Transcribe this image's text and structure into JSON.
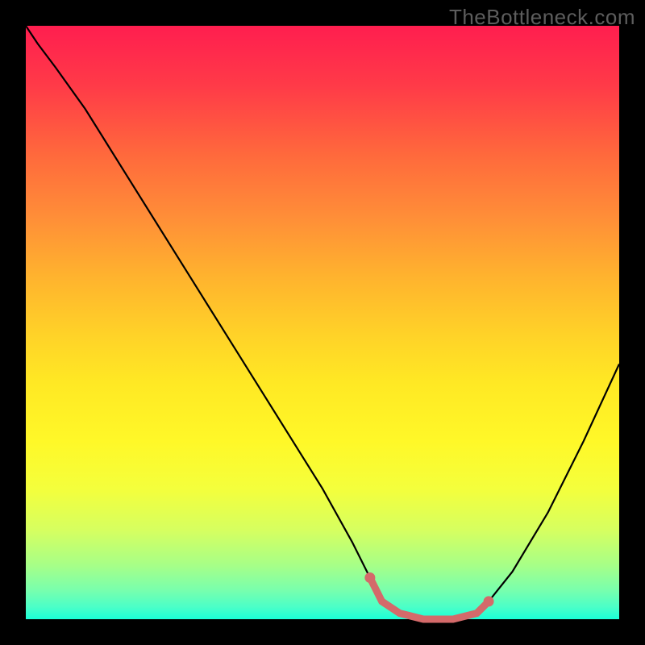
{
  "watermark": "TheBottleneck.com",
  "chart_data": {
    "type": "line",
    "title": "",
    "xlabel": "",
    "ylabel": "",
    "xlim": [
      0,
      1
    ],
    "ylim": [
      0,
      1
    ],
    "series": [
      {
        "name": "bottleneck-curve",
        "color": "#000000",
        "x": [
          0.0,
          0.02,
          0.05,
          0.1,
          0.15,
          0.2,
          0.25,
          0.3,
          0.35,
          0.4,
          0.45,
          0.5,
          0.55,
          0.58,
          0.6,
          0.63,
          0.67,
          0.72,
          0.76,
          0.78,
          0.82,
          0.88,
          0.94,
          1.0
        ],
        "y": [
          1.0,
          0.97,
          0.93,
          0.86,
          0.78,
          0.7,
          0.62,
          0.54,
          0.46,
          0.38,
          0.3,
          0.22,
          0.13,
          0.07,
          0.03,
          0.01,
          0.0,
          0.0,
          0.01,
          0.03,
          0.08,
          0.18,
          0.3,
          0.43
        ]
      },
      {
        "name": "highlight-band",
        "color": "#d46a6a",
        "x": [
          0.58,
          0.6,
          0.63,
          0.67,
          0.72,
          0.76,
          0.78
        ],
        "y": [
          0.07,
          0.03,
          0.01,
          0.0,
          0.0,
          0.01,
          0.03
        ]
      }
    ],
    "highlight_points": [
      {
        "x": 0.58,
        "y": 0.07
      },
      {
        "x": 0.78,
        "y": 0.03
      }
    ]
  }
}
